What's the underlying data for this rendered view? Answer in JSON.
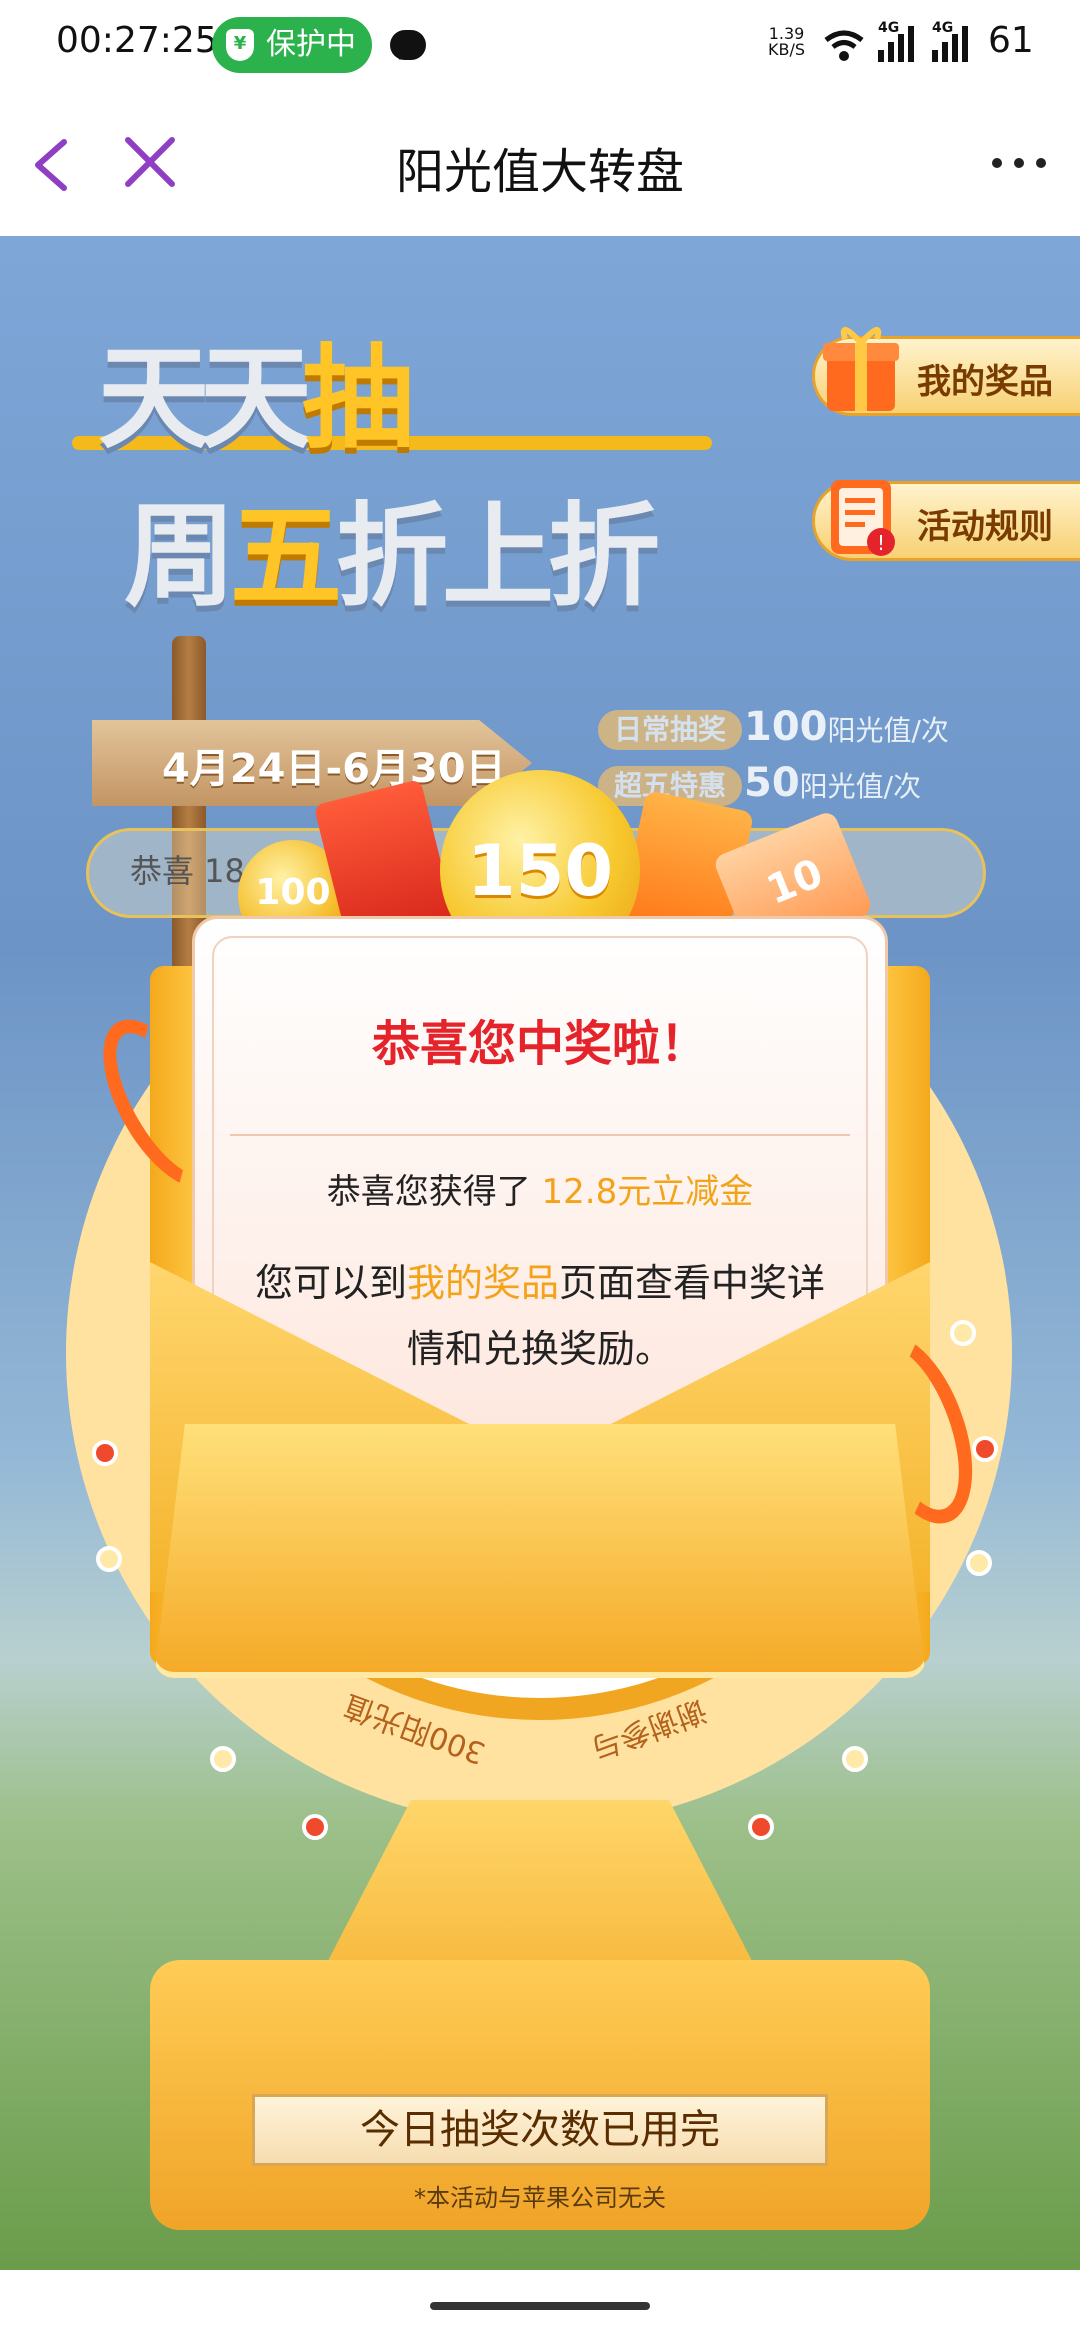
{
  "status_bar": {
    "time": "00:27:25",
    "protect_label": "保护中",
    "net_speed_value": "1.39",
    "net_speed_unit": "KB/S",
    "network_1": "4G",
    "network_2": "4G",
    "battery": "61"
  },
  "nav": {
    "title": "阳光值大转盘"
  },
  "hero": {
    "line1_a": "天天",
    "line1_b": "抽",
    "line2_a": "周",
    "line2_b": "五",
    "line2_c": "折上折"
  },
  "side_buttons": {
    "my_prizes": "我的奖品",
    "rules": "活动规则"
  },
  "event": {
    "date_range": "4月24日-6月30日",
    "tag_daily": "日常抽奖",
    "tag_daily_value": "100",
    "tag_daily_unit": "阳光值/次",
    "tag_super": "超五特惠",
    "tag_super_value": "50",
    "tag_super_unit": "阳光值/次",
    "marquee": "恭喜 18"
  },
  "prize_popup": {
    "coin_big": "150",
    "coin_small": "100",
    "ticket": "10",
    "title": "恭喜您中奖啦！",
    "won_prefix": "恭喜您获得了",
    "won_prize": "12.8元立减金",
    "info_prefix": "您可以到",
    "info_link": "我的奖品",
    "info_suffix": "页面查看中奖详情和兑换奖励。"
  },
  "wheel": {
    "segment_left": "300阳光值",
    "segment_right": "谢谢参与"
  },
  "footer": {
    "done_button": "今日抽奖次数已用完",
    "disclaimer": "*本活动与苹果公司无关"
  },
  "colors": {
    "accent_purple": "#8e3fc4",
    "title_red": "#e5232a",
    "highlight_yellow": "#f3a31a",
    "protect_green": "#2bb24c"
  }
}
